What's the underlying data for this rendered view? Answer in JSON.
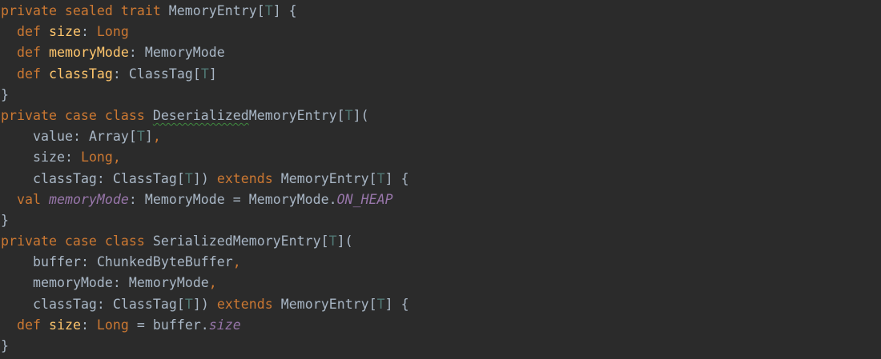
{
  "code": {
    "lines": [
      [
        [
          "kw",
          "private sealed trait "
        ],
        [
          "tp",
          "MemoryEntry"
        ],
        [
          "pl",
          "["
        ],
        [
          "tparam",
          "T"
        ],
        [
          "pl",
          "] {"
        ]
      ],
      [
        [
          "kw",
          "def "
        ],
        [
          "fn",
          "size"
        ],
        [
          "pl",
          ": "
        ],
        [
          "kw",
          "Long"
        ]
      ],
      [
        [
          "kw",
          "def "
        ],
        [
          "fn",
          "memoryMode"
        ],
        [
          "pl",
          ": "
        ],
        [
          "tp",
          "MemoryMode"
        ]
      ],
      [
        [
          "kw",
          "def "
        ],
        [
          "fn",
          "classTag"
        ],
        [
          "pl",
          ": "
        ],
        [
          "tp",
          "ClassTag"
        ],
        [
          "pl",
          "["
        ],
        [
          "tparam",
          "T"
        ],
        [
          "pl",
          "]"
        ]
      ],
      [
        [
          "pl",
          "}"
        ]
      ],
      [
        [
          "kw",
          "private case class "
        ],
        [
          "squig",
          "Deserialized"
        ],
        [
          "tp",
          "MemoryEntry"
        ],
        [
          "pl",
          "["
        ],
        [
          "tparam",
          "T"
        ],
        [
          "pl",
          "]("
        ]
      ],
      [
        [
          "pl",
          "value: "
        ],
        [
          "tp",
          "Array"
        ],
        [
          "pl",
          "["
        ],
        [
          "tparam",
          "T"
        ],
        [
          "pl",
          "]"
        ],
        [
          "kw",
          ","
        ]
      ],
      [
        [
          "pl",
          "size: "
        ],
        [
          "kw",
          "Long,"
        ]
      ],
      [
        [
          "pl",
          "classTag: "
        ],
        [
          "tp",
          "ClassTag"
        ],
        [
          "pl",
          "["
        ],
        [
          "tparam",
          "T"
        ],
        [
          "pl",
          "]) "
        ],
        [
          "kw",
          "extends "
        ],
        [
          "tp",
          "MemoryEntry"
        ],
        [
          "pl",
          "["
        ],
        [
          "tparam",
          "T"
        ],
        [
          "pl",
          "] {"
        ]
      ],
      [
        [
          "kw",
          "val "
        ],
        [
          "ital",
          "memoryMode"
        ],
        [
          "pl",
          ": "
        ],
        [
          "tp",
          "MemoryMode"
        ],
        [
          "pl",
          " = "
        ],
        [
          "tp",
          "MemoryMode."
        ],
        [
          "ital",
          "ON_HEAP"
        ]
      ],
      [
        [
          "pl",
          "}"
        ]
      ],
      [
        [
          "kw",
          "private case class "
        ],
        [
          "tp",
          "SerializedMemoryEntry"
        ],
        [
          "pl",
          "["
        ],
        [
          "tparam",
          "T"
        ],
        [
          "pl",
          "]("
        ]
      ],
      [
        [
          "pl",
          "buffer: "
        ],
        [
          "tp",
          "ChunkedByteBuffer"
        ],
        [
          "kw",
          ","
        ]
      ],
      [
        [
          "pl",
          "memoryMode: "
        ],
        [
          "tp",
          "MemoryMode"
        ],
        [
          "kw",
          ","
        ]
      ],
      [
        [
          "pl",
          "classTag: "
        ],
        [
          "tp",
          "ClassTag"
        ],
        [
          "pl",
          "["
        ],
        [
          "tparam",
          "T"
        ],
        [
          "pl",
          "]) "
        ],
        [
          "kw",
          "extends "
        ],
        [
          "tp",
          "MemoryEntry"
        ],
        [
          "pl",
          "["
        ],
        [
          "tparam",
          "T"
        ],
        [
          "pl",
          "] {"
        ]
      ],
      [
        [
          "kw",
          "def "
        ],
        [
          "fn",
          "size"
        ],
        [
          "pl",
          ": "
        ],
        [
          "kw",
          "Long"
        ],
        [
          "pl",
          " = buffer."
        ],
        [
          "ital",
          "size"
        ]
      ],
      [
        [
          "pl",
          "}"
        ]
      ]
    ],
    "indent": [
      0,
      1,
      1,
      1,
      0,
      0,
      2,
      2,
      2,
      1,
      0,
      0,
      2,
      2,
      2,
      1,
      0
    ]
  }
}
